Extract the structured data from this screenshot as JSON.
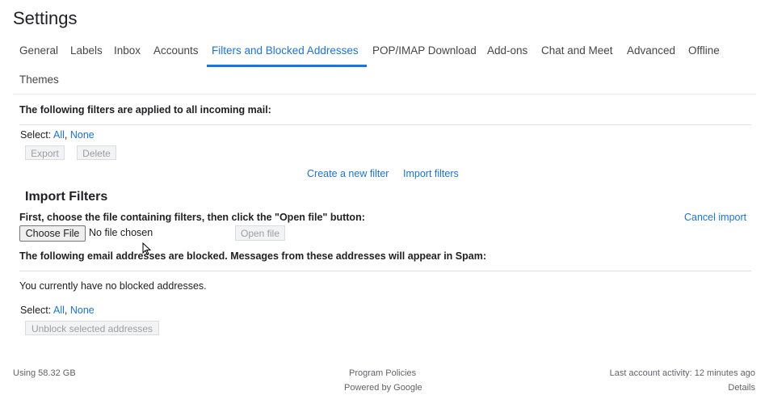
{
  "header": {
    "title": "Settings"
  },
  "tabs": [
    {
      "label": "General"
    },
    {
      "label": "Labels"
    },
    {
      "label": "Inbox"
    },
    {
      "label": "Accounts"
    },
    {
      "label": "Filters and Blocked Addresses",
      "active": true
    },
    {
      "label": "POP/IMAP Download"
    },
    {
      "label": "Add-ons"
    },
    {
      "label": "Chat and Meet"
    },
    {
      "label": "Advanced"
    },
    {
      "label": "Offline"
    },
    {
      "label": "Themes"
    }
  ],
  "filters": {
    "heading": "The following filters are applied to all incoming mail:",
    "select_label": "Select:",
    "select_all": "All",
    "select_none": "None",
    "export_label": "Export",
    "delete_label": "Delete",
    "create_filter": "Create a new filter",
    "import_filters": "Import filters"
  },
  "import": {
    "heading": "Import Filters",
    "instruction": "First, choose the file containing filters, then click the \"Open file\" button:",
    "cancel": "Cancel import",
    "choose_file": "Choose File",
    "no_file": "No file chosen",
    "open_file": "Open file"
  },
  "blocked": {
    "heading": "The following email addresses are blocked. Messages from these addresses will appear in Spam:",
    "empty": "You currently have no blocked addresses.",
    "select_label": "Select:",
    "select_all": "All",
    "select_none": "None",
    "unblock": "Unblock selected addresses"
  },
  "footer": {
    "storage": "Using 58.32 GB",
    "policies": "Program Policies",
    "powered": "Powered by Google",
    "activity": "Last account activity: 12 minutes ago",
    "details": "Details"
  }
}
